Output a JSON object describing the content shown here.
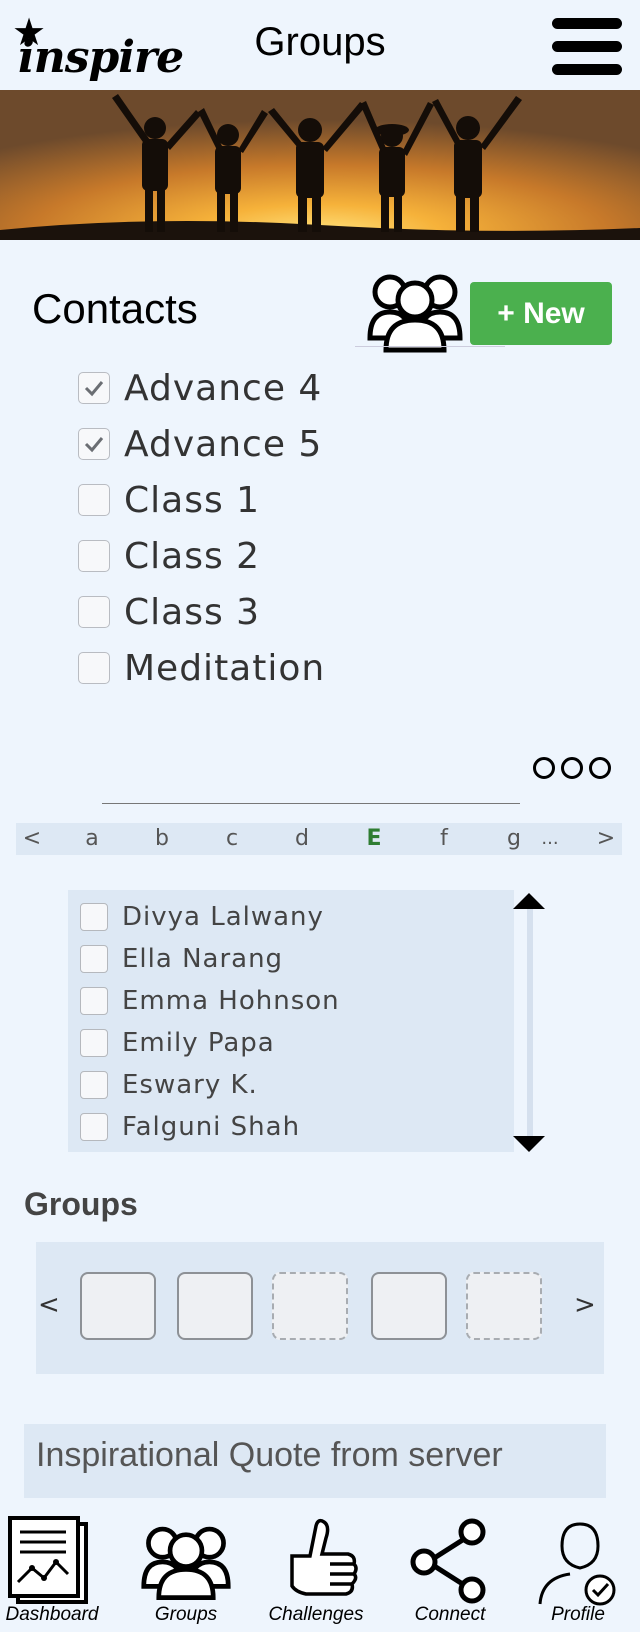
{
  "header": {
    "logo_text": "inspire",
    "title": "Groups"
  },
  "contacts": {
    "title": "Contacts",
    "new_button": "+ New",
    "groups": [
      {
        "label": "Advance 4",
        "checked": true
      },
      {
        "label": "Advance 5",
        "checked": true
      },
      {
        "label": "Class 1",
        "checked": false
      },
      {
        "label": "Class 2",
        "checked": false
      },
      {
        "label": "Class 3",
        "checked": false
      },
      {
        "label": "Meditation",
        "checked": false
      }
    ]
  },
  "alphabet": {
    "prev": "<",
    "letters": [
      "a",
      "b",
      "c",
      "d",
      "E",
      "f",
      "g"
    ],
    "active": "E",
    "ellipsis": "...",
    "next": ">"
  },
  "contact_list": [
    "Divya Lalwany",
    "Ella Narang",
    "Emma Hohnson",
    "Emily Papa",
    "Eswary K.",
    "Falguni Shah"
  ],
  "groups_section": {
    "title": "Groups",
    "prev": "<",
    "next": ">",
    "slots": [
      "solid",
      "solid",
      "dashed",
      "solid",
      "dashed"
    ]
  },
  "quote": "Inspirational Quote from server",
  "nav": [
    {
      "label": "Dashboard",
      "icon": "dashboard-icon"
    },
    {
      "label": "Groups",
      "icon": "groups-icon"
    },
    {
      "label": "Challenges",
      "icon": "thumbs-up-icon"
    },
    {
      "label": "Connect",
      "icon": "share-icon"
    },
    {
      "label": "Profile",
      "icon": "profile-check-icon"
    }
  ],
  "colors": {
    "background": "#eef5fd",
    "new_button": "#4bb04e",
    "active_letter": "#2e7d32",
    "panel": "#dde8f4"
  }
}
